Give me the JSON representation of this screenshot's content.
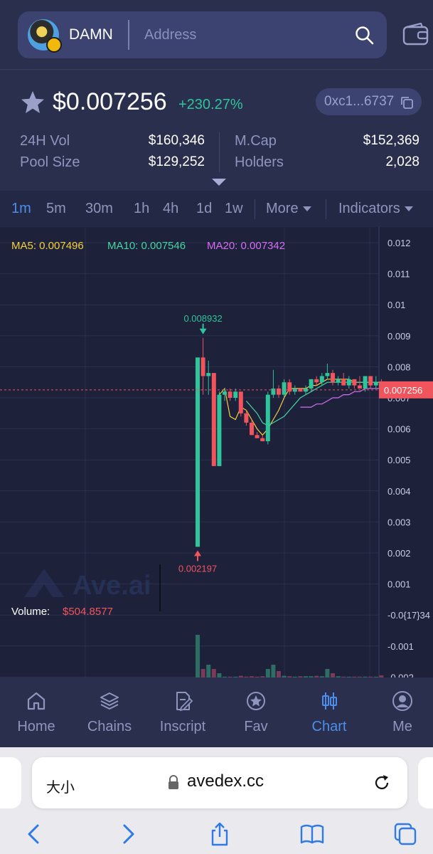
{
  "search": {
    "token_symbol": "DAMN",
    "placeholder": "Address"
  },
  "token": {
    "price": "$0.007256",
    "change": "+230.27%",
    "address_short": "0xc1...6737",
    "stats": [
      {
        "label": "24H Vol",
        "value": "$160,346"
      },
      {
        "label": "Pool Size",
        "value": "$129,252"
      },
      {
        "label": "M.Cap",
        "value": "$152,369"
      },
      {
        "label": "Holders",
        "value": "2,028"
      }
    ]
  },
  "intervals": [
    "1m",
    "5m",
    "30m",
    "1h",
    "4h",
    "1d",
    "1w"
  ],
  "active_interval": "1m",
  "more_label": "More",
  "indicators_label": "Indicators",
  "chart": {
    "ma": [
      {
        "label": "MA5: 0.007496",
        "color": "#f5d03b"
      },
      {
        "label": "MA10: 0.007546",
        "color": "#45d6a4"
      },
      {
        "label": "MA20: 0.007342",
        "color": "#d66ef2"
      }
    ],
    "high_label": "0.008932",
    "low_label": "0.002197",
    "current_price_label": "0.007256",
    "volume_label": "Volume:",
    "volume_value": "$504.8577",
    "watermark": "Ave.ai",
    "y_ticks": [
      "0.012",
      "0.011",
      "0.01",
      "0.009",
      "0.008",
      "0.007",
      "0.006",
      "0.005",
      "0.004",
      "0.003",
      "0.002",
      "0.001",
      "-0.0{17}34",
      "-0.001",
      "-0.002"
    ]
  },
  "chart_data": {
    "type": "candlestick",
    "ylim": [
      -0.002,
      0.012
    ],
    "current_price": 0.007256,
    "high": 0.008932,
    "low": 0.002197,
    "candles": [
      {
        "o": 0.0022,
        "h": 0.0083,
        "l": 0.002197,
        "c": 0.0083
      },
      {
        "o": 0.0083,
        "h": 0.008932,
        "l": 0.0071,
        "c": 0.0077
      },
      {
        "o": 0.0077,
        "h": 0.0082,
        "l": 0.0071,
        "c": 0.0078
      },
      {
        "o": 0.0078,
        "h": 0.0078,
        "l": 0.0048,
        "c": 0.0048
      },
      {
        "o": 0.0048,
        "h": 0.0072,
        "l": 0.0048,
        "c": 0.0071
      },
      {
        "o": 0.0071,
        "h": 0.0073,
        "l": 0.0069,
        "c": 0.0072
      },
      {
        "o": 0.0072,
        "h": 0.0073,
        "l": 0.0069,
        "c": 0.007
      },
      {
        "o": 0.007,
        "h": 0.0073,
        "l": 0.0069,
        "c": 0.0072
      },
      {
        "o": 0.0072,
        "h": 0.0072,
        "l": 0.0064,
        "c": 0.0065
      },
      {
        "o": 0.0065,
        "h": 0.0066,
        "l": 0.0061,
        "c": 0.0062
      },
      {
        "o": 0.0062,
        "h": 0.0063,
        "l": 0.0058,
        "c": 0.0058
      },
      {
        "o": 0.0058,
        "h": 0.0059,
        "l": 0.0057,
        "c": 0.0057
      },
      {
        "o": 0.0057,
        "h": 0.0058,
        "l": 0.0056,
        "c": 0.0056
      },
      {
        "o": 0.0056,
        "h": 0.0072,
        "l": 0.0055,
        "c": 0.0071
      },
      {
        "o": 0.0071,
        "h": 0.0079,
        "l": 0.007,
        "c": 0.0073
      },
      {
        "o": 0.0073,
        "h": 0.0074,
        "l": 0.007,
        "c": 0.0071
      },
      {
        "o": 0.0071,
        "h": 0.0076,
        "l": 0.007,
        "c": 0.0075
      },
      {
        "o": 0.0075,
        "h": 0.0076,
        "l": 0.0071,
        "c": 0.0072
      },
      {
        "o": 0.0072,
        "h": 0.0074,
        "l": 0.0071,
        "c": 0.0073
      },
      {
        "o": 0.0073,
        "h": 0.0073,
        "l": 0.0072,
        "c": 0.0072
      },
      {
        "o": 0.0072,
        "h": 0.0074,
        "l": 0.0071,
        "c": 0.0073
      },
      {
        "o": 0.0073,
        "h": 0.0076,
        "l": 0.0072,
        "c": 0.0076
      },
      {
        "o": 0.0076,
        "h": 0.0077,
        "l": 0.0074,
        "c": 0.0075
      },
      {
        "o": 0.0075,
        "h": 0.0078,
        "l": 0.0074,
        "c": 0.0077
      },
      {
        "o": 0.0077,
        "h": 0.0081,
        "l": 0.0076,
        "c": 0.0078
      },
      {
        "o": 0.0078,
        "h": 0.0079,
        "l": 0.0074,
        "c": 0.0075
      },
      {
        "o": 0.0075,
        "h": 0.0077,
        "l": 0.0074,
        "c": 0.0076
      },
      {
        "o": 0.0076,
        "h": 0.0078,
        "l": 0.0074,
        "c": 0.0074
      },
      {
        "o": 0.0074,
        "h": 0.0077,
        "l": 0.0073,
        "c": 0.0076
      },
      {
        "o": 0.0076,
        "h": 0.0076,
        "l": 0.0073,
        "c": 0.0074
      },
      {
        "o": 0.0074,
        "h": 0.0077,
        "l": 0.0073,
        "c": 0.0073
      },
      {
        "o": 0.0073,
        "h": 0.0077,
        "l": 0.0072,
        "c": 0.0077
      },
      {
        "o": 0.0077,
        "h": 0.0077,
        "l": 0.0073,
        "c": 0.0074
      },
      {
        "o": 0.0074,
        "h": 0.0077,
        "l": 0.0073,
        "c": 0.0075
      },
      {
        "o": 0.0075,
        "h": 0.0076,
        "l": 0.0072,
        "c": 0.007256
      }
    ],
    "ma_lines": {
      "ma5": [
        null,
        null,
        null,
        null,
        0.0071,
        0.0073,
        0.0064,
        0.0063,
        0.0067,
        0.0066,
        0.0063,
        0.006,
        0.0058,
        0.006,
        0.0063,
        0.0066,
        0.007,
        0.0073,
        0.0073,
        0.0073,
        0.0073,
        0.0074,
        0.0074,
        0.0075,
        0.0076,
        0.0076,
        0.0076,
        0.0076,
        0.0076,
        0.0075,
        0.0075,
        0.0075,
        0.0075,
        0.0075,
        0.0075
      ],
      "ma10": [
        null,
        null,
        null,
        null,
        null,
        null,
        null,
        null,
        null,
        0.0069,
        0.0067,
        0.0065,
        0.0062,
        0.0061,
        0.0062,
        0.0063,
        0.0064,
        0.0066,
        0.0068,
        0.007,
        0.0071,
        0.0072,
        0.0073,
        0.0074,
        0.0075,
        0.0075,
        0.0075,
        0.0075,
        0.0075,
        0.0075,
        0.0075,
        0.0075,
        0.0075,
        0.0075,
        0.0075
      ],
      "ma20": [
        null,
        null,
        null,
        null,
        null,
        null,
        null,
        null,
        null,
        null,
        null,
        null,
        null,
        null,
        null,
        null,
        null,
        null,
        null,
        0.0067,
        0.0067,
        0.0067,
        0.0068,
        0.0068,
        0.0069,
        0.007,
        0.007,
        0.0071,
        0.0071,
        0.0072,
        0.0072,
        0.0073,
        0.0073,
        0.0073,
        0.0073
      ]
    },
    "volumes": [
      10,
      2,
      3,
      2,
      1,
      0.2,
      0.2,
      0.2,
      0.4,
      0.2,
      0.3,
      0.2,
      0.3,
      2,
      3,
      1.5,
      0.4,
      0.3,
      0.2,
      0.3,
      0.3,
      0.3,
      0.4,
      0.3,
      2,
      1,
      0.3,
      0.2,
      0.2,
      0.2,
      0.2,
      0.2,
      0.2,
      0.2,
      0.5
    ]
  },
  "nav": [
    {
      "label": "Home",
      "icon": "home-icon"
    },
    {
      "label": "Chains",
      "icon": "layers-icon"
    },
    {
      "label": "Inscript",
      "icon": "inscript-icon"
    },
    {
      "label": "Fav",
      "icon": "fav-icon"
    },
    {
      "label": "Chart",
      "icon": "candlestick-icon"
    },
    {
      "label": "Me",
      "icon": "profile-icon"
    }
  ],
  "active_nav": "Chart",
  "browser": {
    "text_size_label": "大小",
    "url": "avedex.cc"
  },
  "colors": {
    "up": "#2fc49b",
    "down": "#f0555e",
    "accent": "#4d8eea"
  }
}
